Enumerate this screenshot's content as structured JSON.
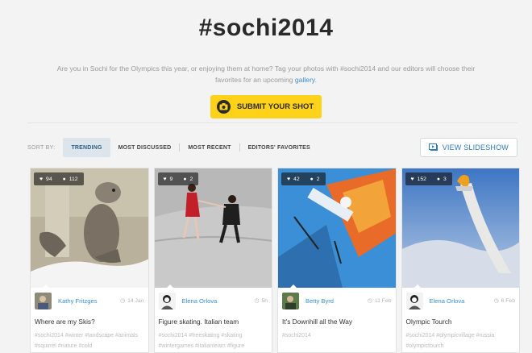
{
  "header": {
    "title": "#sochi2014",
    "subtitle_text": "Are you in Sochi for the Olympics this year, or enjoying them at home? Tag your photos with #sochi2014 and our editors will choose their favorites for an upcoming",
    "subtitle_link": "gallery",
    "subtitle_end": ".",
    "submit_label": "SUBMIT YOUR SHOT"
  },
  "sort": {
    "label": "SORT BY:",
    "tabs": [
      {
        "label": "TRENDING",
        "active": true
      },
      {
        "label": "MOST DISCUSSED"
      },
      {
        "label": "MOST RECENT"
      },
      {
        "label": "EDITORS' FAVORITES"
      }
    ],
    "slideshow_label": "VIEW SLIDESHOW"
  },
  "cards": [
    {
      "likes": "94",
      "comments": "112",
      "user": "Kathy Fritzges",
      "date": "14 Jan",
      "caption": "Where are my Skis?",
      "tags": "#sochi2014 #winter #landscape #animals #squirrel #nature #cold"
    },
    {
      "likes": "9",
      "comments": "2",
      "user": "Elena Orlova",
      "date": "5h",
      "caption": "Figure skating. Italian team",
      "tags": "#sochi2014 #freeskating #skating #wintergames #italianteam #figure"
    },
    {
      "likes": "42",
      "comments": "2",
      "user": "Betty Byrd",
      "date": "11 Feb",
      "caption": "It's Downhill all the Way",
      "tags": "#sochi2014"
    },
    {
      "likes": "152",
      "comments": "3",
      "user": "Elena Orlova",
      "date": "6 Feb",
      "caption": "Olympic Tourch",
      "tags": "#sochi2014 #olympicvillage #russia #olympictourch"
    }
  ],
  "icons": {
    "heart": "heart-icon",
    "comment": "comment-icon",
    "clock": "clock-icon",
    "camera": "camera-icon",
    "slideshow": "slideshow-icon"
  },
  "colors": {
    "accent": "#3b8fd0",
    "submit_bg": "#ffd21a",
    "active_tab_bg": "#dde5ec"
  }
}
